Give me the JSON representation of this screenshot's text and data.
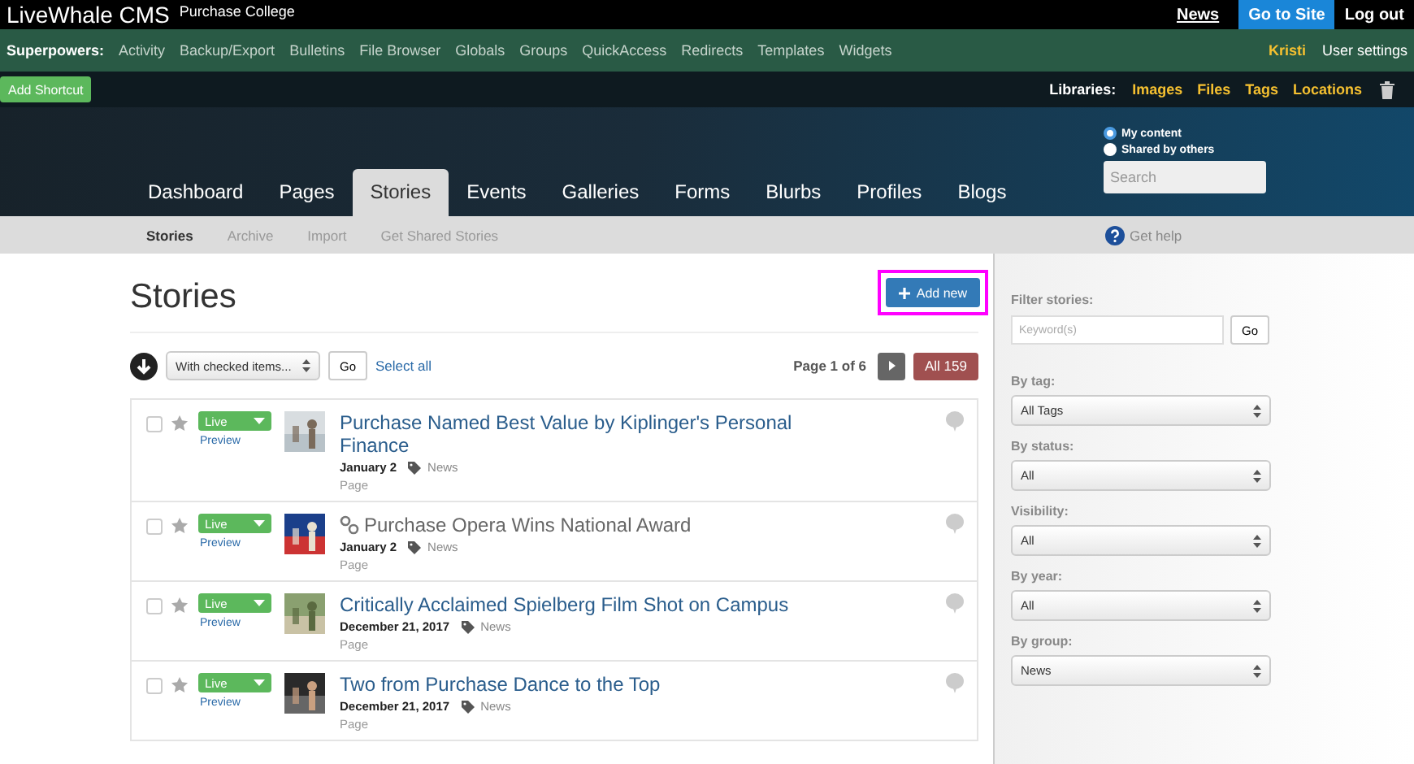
{
  "header": {
    "app_name": "LiveWhale CMS",
    "site_name": "Purchase College",
    "links": [
      {
        "label": "News",
        "kind": "link"
      },
      {
        "label": "Go to Site",
        "kind": "button"
      },
      {
        "label": "Log out",
        "kind": "plain"
      }
    ]
  },
  "superpowers": {
    "label": "Superpowers:",
    "items": [
      "Activity",
      "Backup/Export",
      "Bulletins",
      "File Browser",
      "Globals",
      "Groups",
      "QuickAccess",
      "Redirects",
      "Templates",
      "Widgets"
    ],
    "user": "Kristi",
    "settings": "User settings"
  },
  "shortcut_button": "Add Shortcut",
  "libraries": {
    "label": "Libraries:",
    "items": [
      "Images",
      "Files",
      "Tags",
      "Locations"
    ]
  },
  "tabs": [
    {
      "label": "Dashboard",
      "selected": false
    },
    {
      "label": "Pages",
      "selected": false
    },
    {
      "label": "Stories",
      "selected": true
    },
    {
      "label": "Events",
      "selected": false
    },
    {
      "label": "Galleries",
      "selected": false
    },
    {
      "label": "Forms",
      "selected": false
    },
    {
      "label": "Blurbs",
      "selected": false
    },
    {
      "label": "Profiles",
      "selected": false
    },
    {
      "label": "Blogs",
      "selected": false
    }
  ],
  "content_filter": [
    {
      "label": "My content",
      "selected": true
    },
    {
      "label": "Shared by others",
      "selected": false
    }
  ],
  "search": {
    "placeholder": "Search"
  },
  "subnav": [
    {
      "label": "Stories",
      "selected": true
    },
    {
      "label": "Archive",
      "selected": false
    },
    {
      "label": "Import",
      "selected": false
    },
    {
      "label": "Get Shared Stories",
      "selected": false
    }
  ],
  "help": "Get help",
  "page_title": "Stories",
  "add_button": {
    "label": "Add new",
    "highlighted": true
  },
  "bulk": {
    "select": "With checked items...",
    "go": "Go",
    "select_all": "Select all"
  },
  "pagination": {
    "label": "Page 1 of 6",
    "all": "All 159"
  },
  "stories": [
    {
      "title": "Purchase Named Best Value by Kiplinger's Personal Finance",
      "checked": false,
      "linked": false,
      "status": "Live",
      "preview": "Preview",
      "date": "January 2",
      "tag": "News",
      "type": "Page"
    },
    {
      "title": "Purchase Opera Wins National Award",
      "checked": false,
      "linked": true,
      "status": "Live",
      "preview": "Preview",
      "date": "January 2",
      "tag": "News",
      "type": "Page"
    },
    {
      "title": "Critically Acclaimed Spielberg Film Shot on Campus",
      "checked": false,
      "linked": false,
      "status": "Live",
      "preview": "Preview",
      "date": "December 21, 2017",
      "tag": "News",
      "type": "Page"
    },
    {
      "title": "Two from Purchase Dance to the Top",
      "checked": false,
      "linked": false,
      "status": "Live",
      "preview": "Preview",
      "date": "December 21, 2017",
      "tag": "News",
      "type": "Page"
    }
  ],
  "filters": {
    "title": "Filter stories:",
    "keyword_placeholder": "Keyword(s)",
    "go": "Go",
    "selects": [
      {
        "label": "By tag:",
        "value": "All Tags"
      },
      {
        "label": "By status:",
        "value": "All"
      },
      {
        "label": "Visibility:",
        "value": "All"
      },
      {
        "label": "By year:",
        "value": "All"
      },
      {
        "label": "By group:",
        "value": "News"
      }
    ]
  }
}
